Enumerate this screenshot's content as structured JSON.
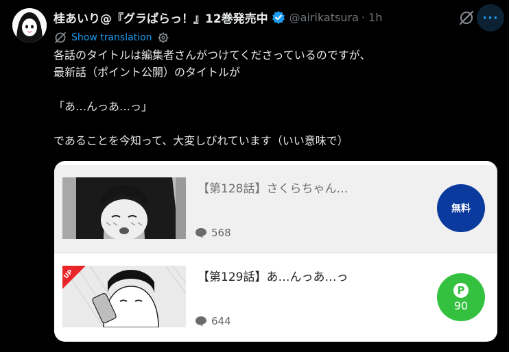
{
  "author": {
    "display_name": "桂あいり@『グラぱらっ！』12巻発売中",
    "handle": "@airikatsura",
    "time": "· 1h"
  },
  "icons": {
    "verified": "verified-badge-icon",
    "grok": "grok-icon",
    "more": "more-icon",
    "translate": "translate-icon",
    "settings": "gear-icon",
    "comment": "comment-bubble-icon",
    "point": "point-coin-icon"
  },
  "translation": {
    "label": "Show translation"
  },
  "tweet": {
    "lines": [
      "各話のタイトルは編集者さんがつけてくださっているのですが、",
      "最新話（ポイント公開）のタイトルが",
      "",
      "「あ…んっあ…っ」",
      "",
      "であることを今知って、大変しびれています（いい意味で）"
    ]
  },
  "card": {
    "episodes": [
      {
        "title": "【第128話】さくらちゃん…",
        "comments": "568",
        "badge": "無料"
      },
      {
        "title": "【第129話】あ…んっあ…っ",
        "comments": "644",
        "up_label": "UP",
        "point_symbol": "P",
        "points": "90"
      }
    ]
  },
  "colors": {
    "accent": "#1d9bf0",
    "free_badge": "#0b3a9e",
    "point_badge": "#33c13f",
    "up_ribbon": "#e8262a"
  }
}
